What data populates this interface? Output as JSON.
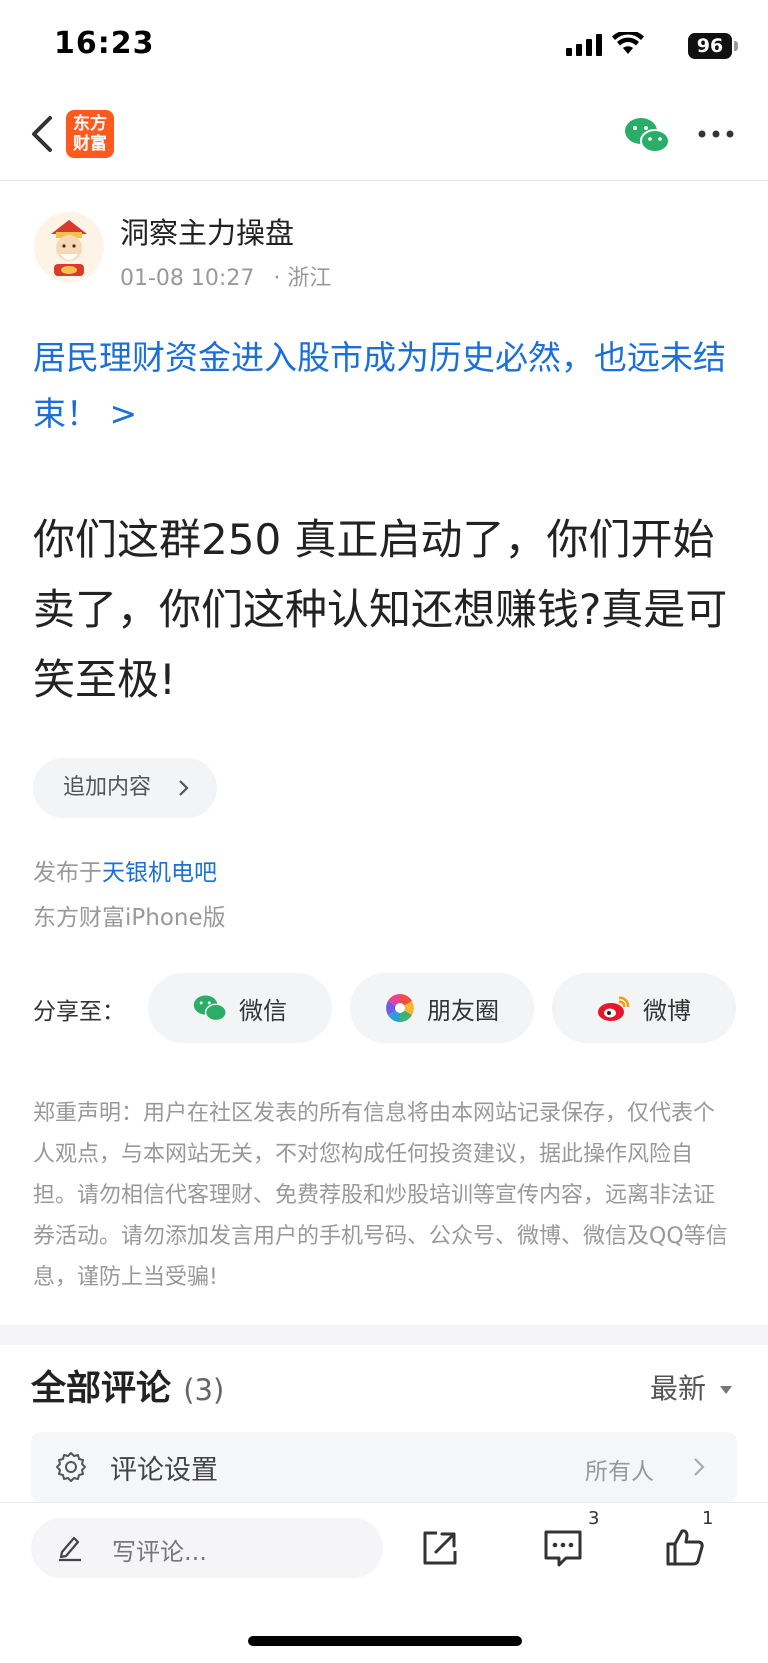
{
  "status_bar": {
    "time": "16:23",
    "battery": "96"
  },
  "nav": {
    "logo_text_line1": "东方",
    "logo_text_line2": "财富"
  },
  "post": {
    "author": "洞察主力操盘",
    "date": "01-08 10:27",
    "location": "· 浙江",
    "linked_title": "居民理财资金进入股市成为历史必然，也远未结束！ >",
    "content": "你们这群250 真正启动了，你们开始卖了，你们这种认知还想赚钱?真是可笑至极!",
    "append_label": "追加内容",
    "posted_prefix": "发布于",
    "posted_bar": "天银机电吧",
    "device": "东方财富iPhone版"
  },
  "share": {
    "label": "分享至：",
    "targets": [
      {
        "label": "微信",
        "icon": "wechat-icon"
      },
      {
        "label": "朋友圈",
        "icon": "moments-icon"
      },
      {
        "label": "微博",
        "icon": "weibo-icon"
      }
    ]
  },
  "disclaimer": "郑重声明：用户在社区发表的所有信息将由本网站记录保存，仅代表个人观点，与本网站无关，不对您构成任何投资建议，据此操作风险自担。请勿相信代客理财、免费荐股和炒股培训等宣传内容，远离非法证券活动。请勿添加发言用户的手机号码、公众号、微博、微信及QQ等信息，谨防上当受骗!",
  "comments": {
    "title": "全部评论",
    "count": "(3)",
    "sort": "最新",
    "settings_label": "评论设置",
    "settings_value": "所有人"
  },
  "bottom_bar": {
    "write_placeholder": "写评论...",
    "comment_count": "3",
    "like_count": "1"
  },
  "colors": {
    "link": "#1a6fd8",
    "brand": "#ff5a1e",
    "wechat": "#2aae67"
  }
}
